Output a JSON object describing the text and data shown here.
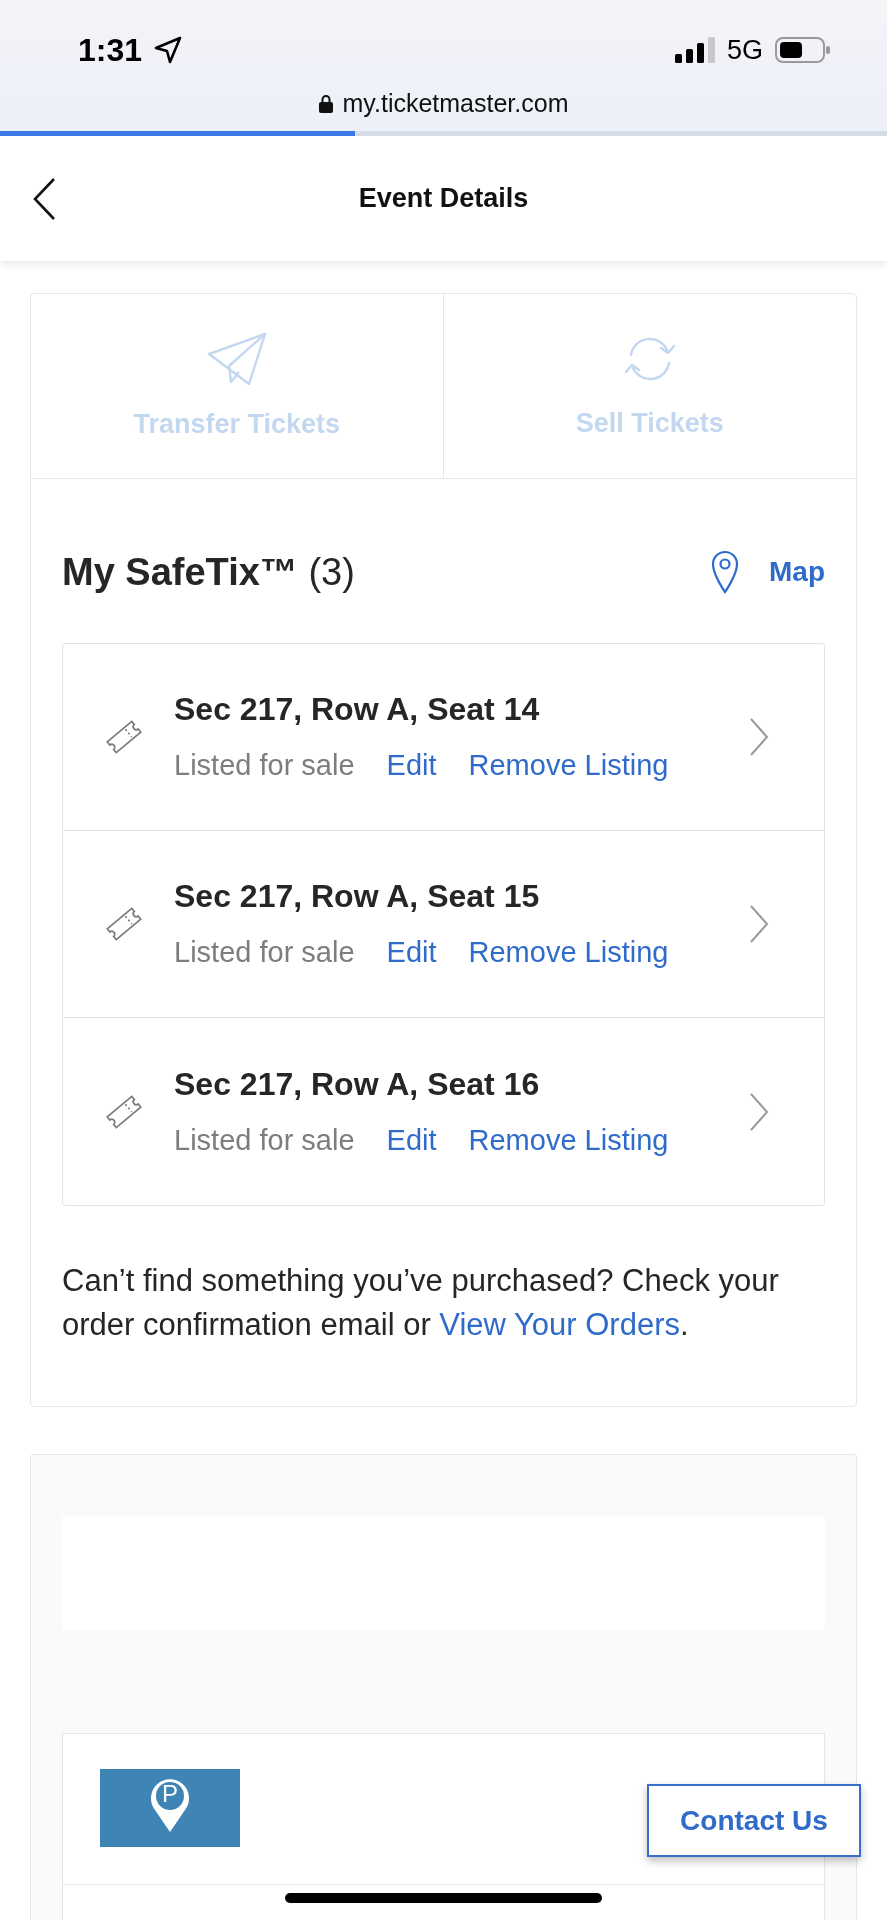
{
  "status_bar": {
    "time": "1:31",
    "network": "5G"
  },
  "browser": {
    "url": "my.ticketmaster.com",
    "page_load": {
      "level": 0.4
    }
  },
  "header": {
    "title": "Event Details"
  },
  "actions": [
    {
      "kind": "transfer",
      "label": "Transfer Tickets",
      "disabled": true
    },
    {
      "kind": "sell",
      "label": "Sell Tickets",
      "disabled": true
    }
  ],
  "tickets_section": {
    "title": "**My SafeTix™** (3)",
    "map_link": "Map",
    "tickets": [
      {
        "title": "Sec 217, Row A, Seat 14",
        "status": "Listed for sale",
        "actions": [
          "Edit",
          "Remove Listing"
        ]
      },
      {
        "title": "Sec 217, Row A, Seat 15",
        "status": "Listed for sale",
        "actions": [
          "Edit",
          "Remove Listing"
        ]
      },
      {
        "title": "Sec 217, Row A, Seat 16",
        "status": "Listed for sale",
        "actions": [
          "Edit",
          "Remove Listing"
        ]
      }
    ],
    "note": {
      "text": "Can’t find something you’ve purchased? Check your order confirmation email or ",
      "link": "View Your Orders",
      "end": "."
    }
  },
  "extras_section": {
    "rows": [
      {
        "kind": "parking",
        "badge": "P"
      },
      {
        "kind": "blank"
      }
    ]
  },
  "contact_button": {
    "label": "Contact Us"
  }
}
